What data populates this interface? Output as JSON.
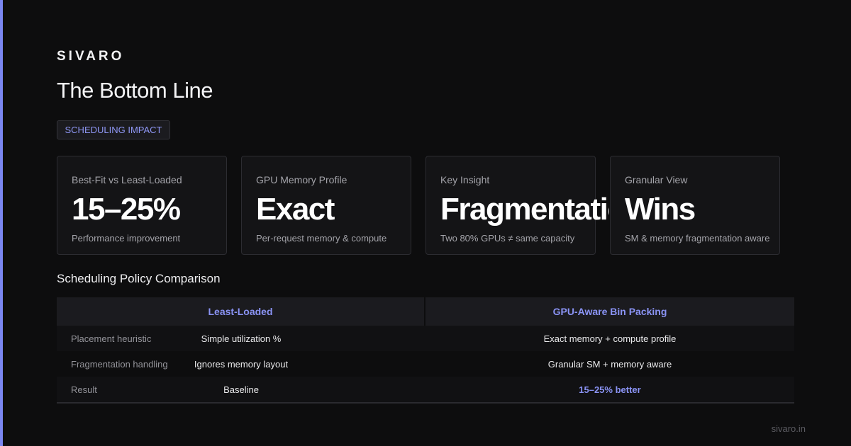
{
  "brand": "SIVARO",
  "title": "The Bottom Line",
  "badge": "SCHEDULING IMPACT",
  "cards": [
    {
      "label": "Best-Fit vs Least-Loaded",
      "value": "15–25%",
      "sub": "Performance improvement"
    },
    {
      "label": "GPU Memory Profile",
      "value": "Exact",
      "sub": "Per-request memory & compute"
    },
    {
      "label": "Key Insight",
      "value": "Fragmentation",
      "sub": "Two 80% GPUs ≠ same capacity"
    },
    {
      "label": "Granular View",
      "value": "Wins",
      "sub": "SM & memory fragmentation aware"
    }
  ],
  "comparison": {
    "title": "Scheduling Policy Comparison",
    "headers": [
      "Least-Loaded",
      "GPU-Aware Bin Packing"
    ],
    "rows": [
      {
        "label": "Placement heuristic",
        "left": "Simple utilization %",
        "right": "Exact memory + compute profile"
      },
      {
        "label": "Fragmentation handling",
        "left": "Ignores memory layout",
        "right": "Granular SM + memory aware"
      },
      {
        "label": "Result",
        "left": "Baseline",
        "right": "15–25% better"
      }
    ]
  },
  "footer": "sivaro.in",
  "colors": {
    "accent": "#7a86f0",
    "background": "#0d0d0e"
  }
}
